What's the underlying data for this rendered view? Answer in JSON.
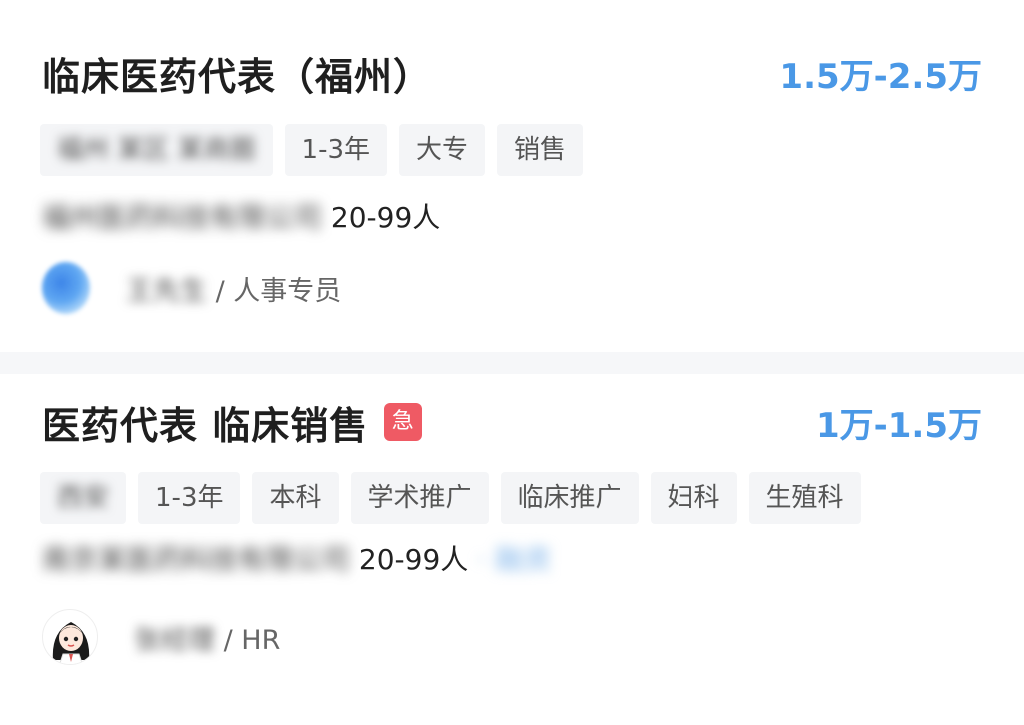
{
  "jobs": [
    {
      "title": "临床医药代表（福州）",
      "urgent_badge": "",
      "salary": "1.5万-2.5万",
      "tags": [
        "福州 某区 某商圈",
        "1-3年",
        "大专",
        "销售"
      ],
      "company": "福州医药科技有限公司",
      "company_size": " 20-99人",
      "company_extra": "",
      "recruiter_name": "王先生",
      "recruiter_role": "/ 人事专员",
      "avatar": "blue-blurred-avatar"
    },
    {
      "title": "医药代表 临床销售",
      "urgent_badge": "急",
      "salary": "1万-1.5万",
      "tags": [
        "西安",
        "1-3年",
        "本科",
        "学术推广",
        "临床推广",
        "妇科",
        "生殖科"
      ],
      "company": "南京某医药科技有限公司",
      "company_size": " 20-99人",
      "company_extra": "· 融资",
      "recruiter_name": "张经理",
      "recruiter_role": "/ HR",
      "avatar": "cartoon-girl-avatar"
    }
  ],
  "colors": {
    "salary": "#4a98e6",
    "urgent_badge": "#ef5a64",
    "tag_bg": "#f4f5f7",
    "divider": "#f6f7f9"
  }
}
